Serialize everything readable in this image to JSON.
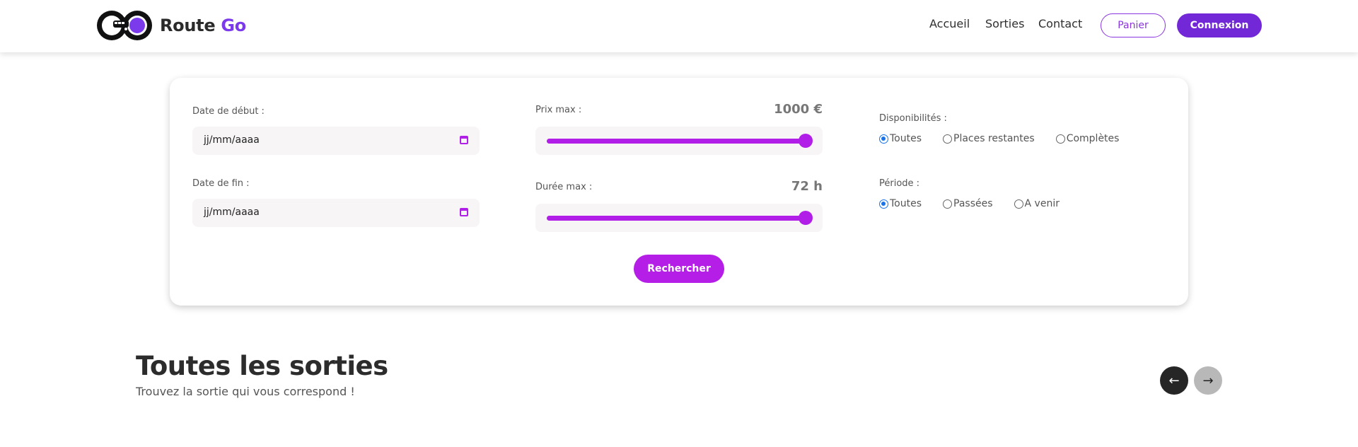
{
  "header": {
    "brand_name": "Route",
    "brand_accent": "Go",
    "nav": [
      "Accueil",
      "Sorties",
      "Contact"
    ],
    "cart_label": "Panier",
    "login_label": "Connexion"
  },
  "filters": {
    "start_date": {
      "label": "Date de début :",
      "value": "jj/mm/aaaa"
    },
    "end_date": {
      "label": "Date de fin :",
      "value": "jj/mm/aaaa"
    },
    "price": {
      "label": "Prix max :",
      "value_text": "1000 €",
      "value": 1000,
      "max": 1000
    },
    "duration": {
      "label": "Durée max :",
      "value_text": "72 h",
      "value": 72,
      "max": 72
    },
    "availability": {
      "label": "Disponibilités :",
      "options": [
        "Toutes",
        "Places restantes",
        "Complètes"
      ],
      "selected": "Toutes"
    },
    "period": {
      "label": "Période :",
      "options": [
        "Toutes",
        "Passées",
        "A venir"
      ],
      "selected": "Toutes"
    },
    "search_label": "Rechercher"
  },
  "section": {
    "title": "Toutes les sorties",
    "subtitle": "Trouvez la sortie qui vous correspond !",
    "prev_icon": "arrow-left-icon",
    "next_icon": "arrow-right-icon"
  },
  "colors": {
    "brand_purple": "#7228d6",
    "accent_magenta": "#b01ee8",
    "radio_blue": "#1a73e8"
  }
}
